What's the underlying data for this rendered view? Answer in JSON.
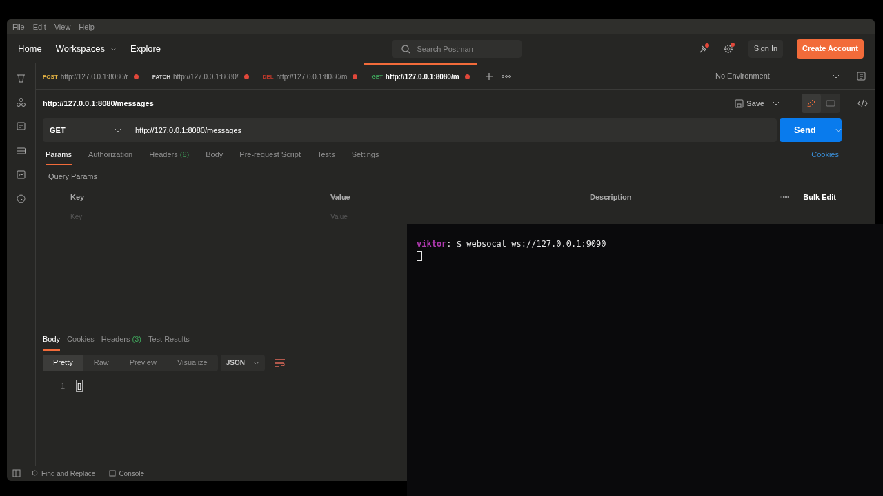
{
  "menu": [
    "File",
    "Edit",
    "View",
    "Help"
  ],
  "nav": [
    {
      "label": "Home",
      "dropdown": false
    },
    {
      "label": "Workspaces",
      "dropdown": true
    },
    {
      "label": "Explore",
      "dropdown": false
    }
  ],
  "search": {
    "placeholder": "Search Postman"
  },
  "sign_in": "Sign In",
  "create_account": "Create Account",
  "request_tabs": [
    {
      "method": "POST",
      "color": "#e5b343",
      "url": "http://127.0.0.1:8080/r",
      "unsaved": true,
      "selected": false
    },
    {
      "method": "PATCH",
      "color": "#d0d0d0",
      "url": "http://127.0.0.1:8080/",
      "unsaved": true,
      "selected": false
    },
    {
      "method": "DEL",
      "color": "#c0392b",
      "url": "http://127.0.0.1:8080/m",
      "unsaved": true,
      "selected": false
    },
    {
      "method": "GET",
      "color": "#3fa35b",
      "url": "http://127.0.0.1:8080/m",
      "unsaved": true,
      "selected": true
    }
  ],
  "environment": "No Environment",
  "request_title": "http://127.0.0.1:8080/messages",
  "save": "Save",
  "modes": [
    {
      "kind": "edit",
      "selected": true
    },
    {
      "kind": "docs",
      "selected": false
    }
  ],
  "method": "GET",
  "url": "http://127.0.0.1:8080/messages",
  "send": "Send",
  "param_tabs": [
    {
      "label": "Params",
      "selected": true
    },
    {
      "label": "Authorization",
      "selected": false
    },
    {
      "label": "Headers",
      "count": "(6)",
      "selected": false
    },
    {
      "label": "Body",
      "selected": false
    },
    {
      "label": "Pre-request Script",
      "selected": false
    },
    {
      "label": "Tests",
      "selected": false
    },
    {
      "label": "Settings",
      "selected": false
    }
  ],
  "cookies_link": "Cookies",
  "query_params": {
    "title": "Query Params",
    "columns": [
      "Key",
      "Value",
      "Description"
    ],
    "bulk_edit": "Bulk Edit",
    "placeholders": [
      "Key",
      "Value"
    ]
  },
  "response_tabs": [
    {
      "label": "Body",
      "selected": true
    },
    {
      "label": "Cookies",
      "selected": false
    },
    {
      "label": "Headers",
      "count": "(3)",
      "selected": false
    },
    {
      "label": "Test Results",
      "selected": false
    }
  ],
  "view_modes": [
    {
      "label": "Pretty",
      "selected": true
    },
    {
      "label": "Raw",
      "selected": false
    },
    {
      "label": "Preview",
      "selected": false
    },
    {
      "label": "Visualize",
      "selected": false
    }
  ],
  "format": "JSON",
  "code_lines": [
    {
      "number": "1",
      "text": "[]"
    }
  ],
  "footer": [
    "Find and Replace",
    "Console"
  ],
  "terminal": {
    "user": "viktor",
    "prompt": ": $ ",
    "command": "websocat ws://127.0.0.1:9090"
  }
}
